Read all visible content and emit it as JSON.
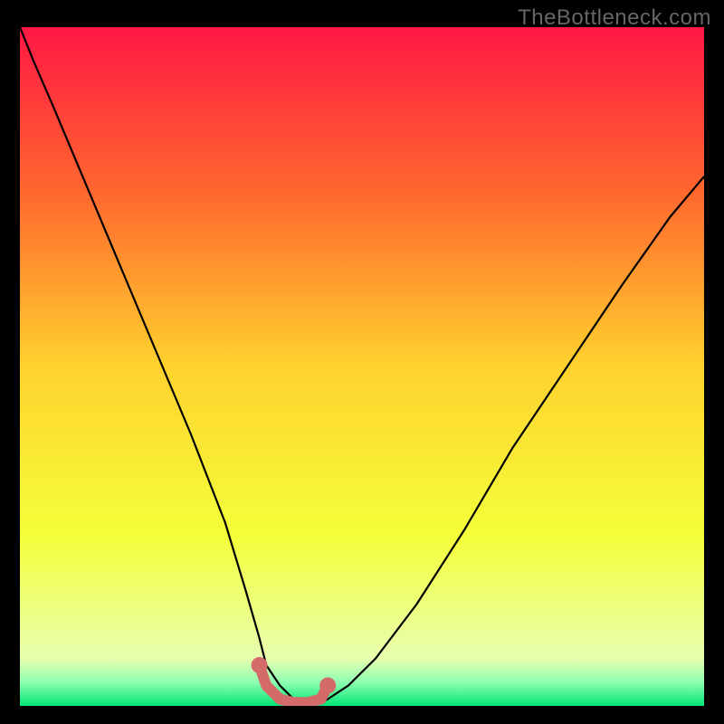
{
  "watermark": "TheBottleneck.com",
  "chart_data": {
    "type": "line",
    "title": "",
    "xlabel": "",
    "ylabel": "",
    "xlim": [
      0,
      100
    ],
    "ylim": [
      0,
      100
    ],
    "series": [
      {
        "name": "bottleneck-curve",
        "x": [
          0,
          2,
          5,
          10,
          15,
          20,
          25,
          30,
          33,
          35,
          36,
          38,
          40,
          42,
          44,
          45,
          48,
          52,
          58,
          65,
          72,
          80,
          88,
          95,
          100
        ],
        "y": [
          100,
          95,
          88,
          76,
          64,
          52,
          40,
          27,
          17,
          10,
          6,
          3,
          1,
          0.5,
          0.5,
          1,
          3,
          7,
          15,
          26,
          38,
          50,
          62,
          72,
          78
        ]
      },
      {
        "name": "optimal-range-marker",
        "x": [
          35,
          36,
          38,
          40,
          42,
          44,
          45
        ],
        "y": [
          6,
          3,
          1,
          0.5,
          0.5,
          1,
          3
        ]
      }
    ],
    "background_gradient": {
      "stops": [
        {
          "pos": 0.0,
          "color": "#ff1744"
        },
        {
          "pos": 0.25,
          "color": "#ff6a2e"
        },
        {
          "pos": 0.5,
          "color": "#ffd22e"
        },
        {
          "pos": 0.75,
          "color": "#f4ff3a"
        },
        {
          "pos": 0.93,
          "color": "#e8ffb0"
        },
        {
          "pos": 0.965,
          "color": "#8fffb0"
        },
        {
          "pos": 1.0,
          "color": "#00e676"
        }
      ]
    },
    "colors": {
      "curve": "#000000",
      "marker": "#d46a6a",
      "frame": "#000000"
    }
  }
}
